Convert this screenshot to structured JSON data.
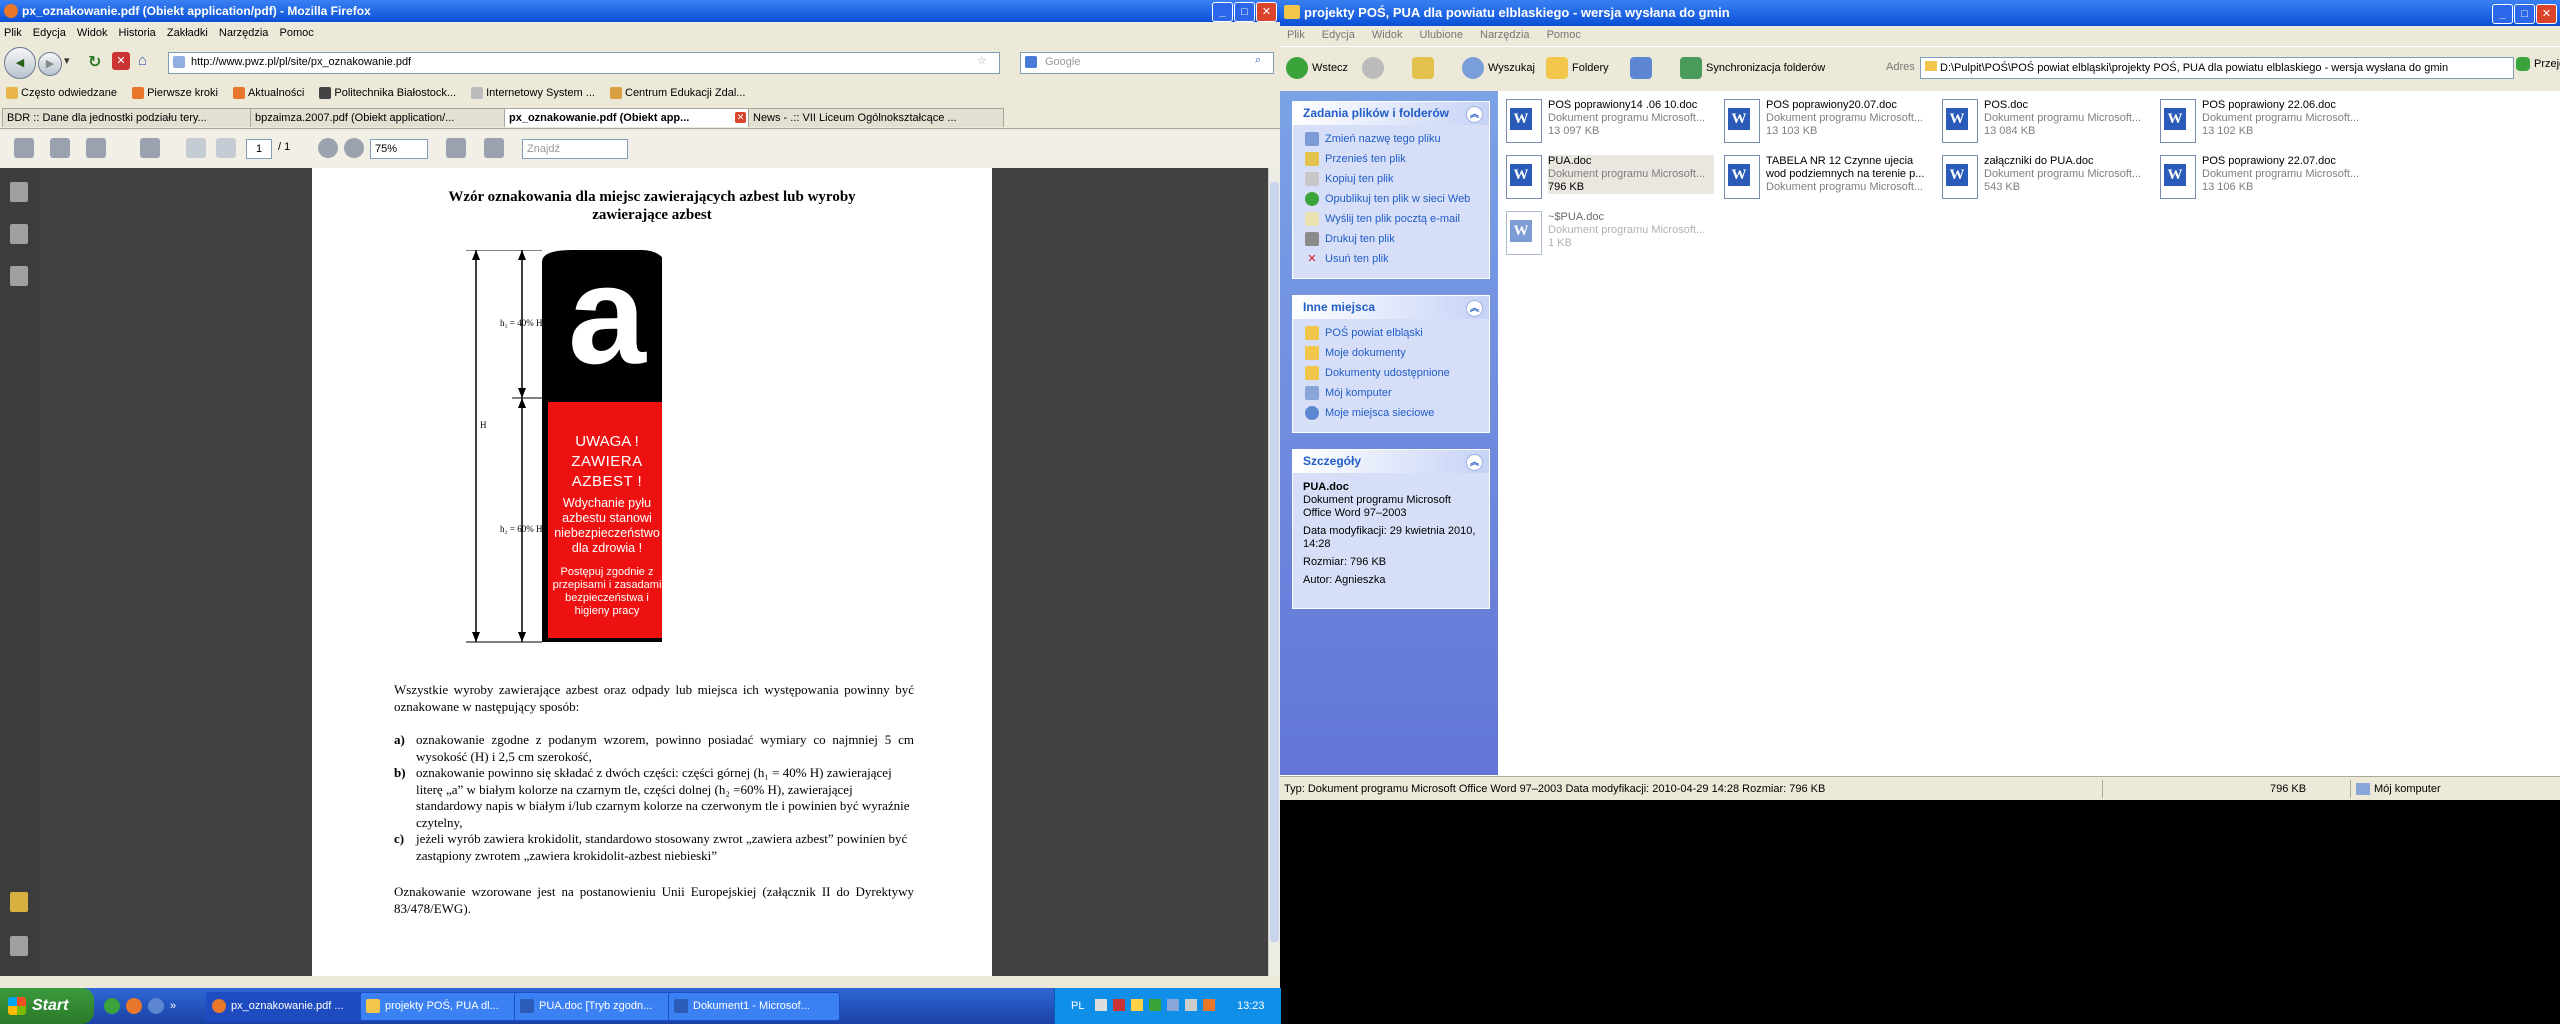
{
  "firefox": {
    "title": "px_oznakowanie.pdf (Obiekt application/pdf) - Mozilla Firefox",
    "menu": [
      "Plik",
      "Edycja",
      "Widok",
      "Historia",
      "Zakładki",
      "Narzędzia",
      "Pomoc"
    ],
    "url": "http://www.pwz.pl/pl/site/px_oznakowanie.pdf",
    "search_placeholder": "Google",
    "bookmarks": [
      "Często odwiedzane",
      "Pierwsze kroki",
      "Aktualności",
      "Politechnika Białostock...",
      "Internetowy System ...",
      "Centrum Edukacji Zdal..."
    ],
    "tabs": [
      {
        "label": "BDR :: Dane dla jednostki podziału tery..."
      },
      {
        "label": "bpzaimza.2007.pdf (Obiekt application/..."
      },
      {
        "label": "px_oznakowanie.pdf (Obiekt app..."
      },
      {
        "label": "News - .:: VII Liceum Ogólnokształcące ..."
      }
    ],
    "pdf_toolbar": {
      "page": "1",
      "pages": "/ 1",
      "zoom": "75%",
      "find_placeholder": "Znajdź"
    }
  },
  "pdf": {
    "title": "Wzór oznakowania dla miejsc zawierających azbest lub wyroby zawierające azbest",
    "sign": {
      "letter": "a",
      "warning1": "UWAGA !",
      "warning2": "ZAWIERA AZBEST !",
      "text1": "Wdychanie pyłu azbestu stanowi niebezpieczeństwo dla zdrowia !",
      "text2": "Postępuj zgodnie z przepisami i zasadami bezpieczeństwa i higieny pracy",
      "label_h1": "h₁ = 40% H",
      "label_h": "H",
      "label_h2": "h₂ = 60% H"
    },
    "intro": "Wszystkie wyroby zawierające azbest oraz odpady lub miejsca ich występowania powinny być oznakowane w następujący sposób:",
    "list": [
      {
        "marker": "a)",
        "text": "oznakowanie zgodne z podanym wzorem, powinno posiadać wymiary co najmniej 5 cm wysokość (H) i 2,5 cm szerokość,"
      },
      {
        "marker": "b)",
        "text": "oznakowanie powinno się składać z dwóch części: części górnej (h₁ = 40% H) zawierającej literę „a” w białym kolorze na czarnym tle, części dolnej (h₂ =60% H), zawierającej standardowy napis w białym i/lub czarnym kolorze na czerwonym tle i powinien  być wyraźnie czytelny,"
      },
      {
        "marker": "c)",
        "text": "jeżeli wyrób zawiera krokidolit, standardowo stosowany zwrot „zawiera azbest” powinien być zastąpiony zwrotem „zawiera krokidolit-azbest niebieski”"
      }
    ],
    "footer": "Oznakowanie wzorowane jest na postanowieniu Unii Europejskiej (załącznik II do Dyrektywy 83/478/EWG)."
  },
  "explorer": {
    "title": "projekty POŚ, PUA dla powiatu elblaskiego - wersja wysłana do gmin",
    "menu": [
      "Plik",
      "Edycja",
      "Widok",
      "Ulubione",
      "Narzędzia",
      "Pomoc"
    ],
    "toolbar": {
      "back": "Wstecz",
      "search": "Wyszukaj",
      "folders": "Foldery",
      "sync": "Synchronizacja folderów"
    },
    "address_label": "Adres",
    "address": "D:\\Pulpit\\POŚ\\POŚ powiat elbląski\\projekty POŚ, PUA dla powiatu elblaskiego - wersja wysłana do gmin",
    "go": "Przejdź",
    "tasks": {
      "title": "Zadania plików i folderów",
      "items": [
        "Zmień nazwę tego pliku",
        "Przenieś ten plik",
        "Kopiuj ten plik",
        "Opublikuj ten plik w sieci Web",
        "Wyślij ten plik pocztą e-mail",
        "Drukuj ten plik",
        "Usuń ten plik"
      ]
    },
    "places": {
      "title": "Inne miejsca",
      "items": [
        "POŚ powiat elbląski",
        "Moje dokumenty",
        "Dokumenty udostępnione",
        "Mój komputer",
        "Moje miejsca sieciowe"
      ]
    },
    "details": {
      "title": "Szczegóły",
      "name": "PUA.doc",
      "type": "Dokument programu Microsoft Office Word 97–2003",
      "modified": "Data modyfikacji: 29 kwietnia 2010, 14:28",
      "size": "Rozmiar: 796 KB",
      "author": "Autor: Agnieszka"
    },
    "files": [
      {
        "name": "POŚ poprawiony14 .06 10.doc",
        "type": "Dokument programu Microsoft...",
        "size": "13 097 KB"
      },
      {
        "name": "POŚ poprawiony20.07.doc",
        "type": "Dokument programu Microsoft...",
        "size": "13 103 KB"
      },
      {
        "name": "POS.doc",
        "type": "Dokument programu Microsoft...",
        "size": "13 084 KB"
      },
      {
        "name": "POŚ poprawiony 22.06.doc",
        "type": "Dokument programu Microsoft...",
        "size": "13 102 KB"
      },
      {
        "name": "PUA.doc",
        "type": "Dokument programu Microsoft...",
        "size": "796 KB"
      },
      {
        "name": "TABELA NR 12 Czynne ujecia wod podziemnych na terenie p...",
        "type": "Dokument programu Microsoft...",
        "size": ""
      },
      {
        "name": "załączniki do PUA.doc",
        "type": "Dokument programu Microsoft...",
        "size": "543 KB"
      },
      {
        "name": "POŚ poprawiony 22.07.doc",
        "type": "Dokument programu Microsoft...",
        "size": "13 106 KB"
      },
      {
        "name": "~$PUA.doc",
        "type": "Dokument programu Microsoft...",
        "size": "1 KB"
      }
    ],
    "status": {
      "text": "Typ: Dokument programu Microsoft Office Word 97–2003 Data modyfikacji: 2010-04-29 14:28 Rozmiar: 796 KB",
      "size": "796 KB",
      "zone": "Mój komputer"
    }
  },
  "taskbar": {
    "start": "Start",
    "tasks": [
      "px_oznakowanie.pdf ...",
      "projekty POŚ, PUA dl...",
      "PUA.doc [Tryb zgodn...",
      "Dokument1 - Microsof..."
    ],
    "lang": "PL",
    "clock": "13:23"
  }
}
